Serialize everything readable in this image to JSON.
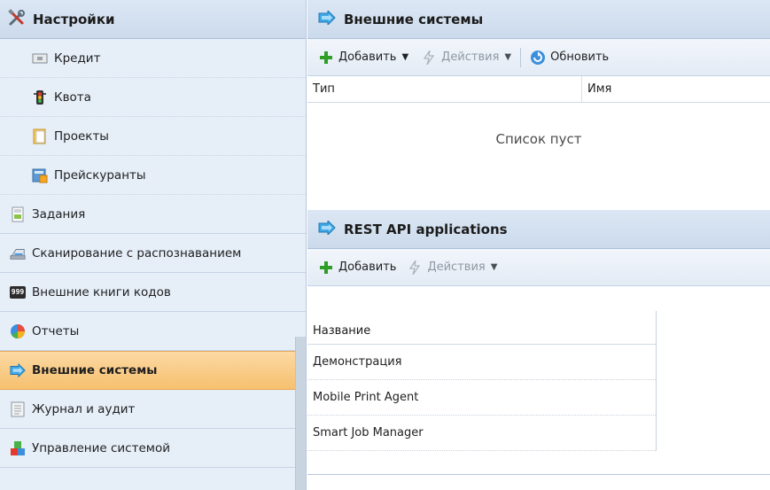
{
  "sidebar": {
    "title": "Настройки",
    "title_icon": "tools-icon",
    "items": [
      {
        "label": "Кредит",
        "icon": "credit-icon",
        "sub": true
      },
      {
        "label": "Квота",
        "icon": "traffic-light-icon",
        "sub": true
      },
      {
        "label": "Проекты",
        "icon": "folder-icon",
        "sub": true
      },
      {
        "label": "Прейскуранты",
        "icon": "price-list-icon",
        "sub": true
      },
      {
        "label": "Задания",
        "icon": "document-icon",
        "sub": false
      },
      {
        "label": "Сканирование с распознаванием",
        "icon": "scanner-icon",
        "sub": false
      },
      {
        "label": "Внешние книги кодов",
        "icon": "codebook-icon",
        "icon_text": "999",
        "sub": false
      },
      {
        "label": "Отчеты",
        "icon": "pie-chart-icon",
        "sub": false
      },
      {
        "label": "Внешние системы",
        "icon": "external-systems-icon",
        "sub": false,
        "active": true
      },
      {
        "label": "Журнал и аудит",
        "icon": "journal-icon",
        "sub": false
      },
      {
        "label": "Управление системой",
        "icon": "system-management-icon",
        "sub": false
      }
    ]
  },
  "external": {
    "title": "Внешние системы",
    "toolbar": {
      "add_label": "Добавить",
      "actions_label": "Действия",
      "refresh_label": "Обновить"
    },
    "columns": [
      "Тип",
      "Имя"
    ],
    "empty_text": "Список пуст"
  },
  "rest": {
    "title": "REST API applications",
    "toolbar": {
      "add_label": "Добавить",
      "actions_label": "Действия"
    },
    "column": "Название",
    "rows": [
      "Демонстрация",
      "Mobile Print Agent",
      "Smart Job Manager"
    ]
  },
  "colors": {
    "accent_orange": "#f6c06e",
    "header_blue": "#cbdaec",
    "sidebar_bg": "#e6eef8",
    "add_green": "#2f9e27"
  }
}
